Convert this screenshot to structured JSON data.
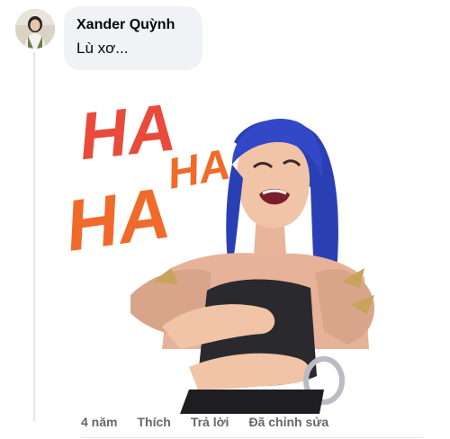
{
  "comment": {
    "author": "Xander Quỳnh",
    "text": "Lù xơ...",
    "avatar_icon": "user-avatar-photo",
    "sticker": {
      "icon": "laughing-character-sticker",
      "caption_line1": "HA",
      "caption_line2": "HA",
      "caption_line3": "HA HA"
    }
  },
  "actions": {
    "time": "4 năm",
    "like_label": "Thích",
    "reply_label": "Trả lời",
    "edited_label": "Đã chỉnh sửa"
  },
  "colors": {
    "bubble_bg": "#f0f2f5",
    "text": "#050505",
    "secondary_text": "#65676b",
    "ha_red": "#e84a3c",
    "ha_orange": "#f06a2a",
    "hair": "#2b3fb5"
  }
}
